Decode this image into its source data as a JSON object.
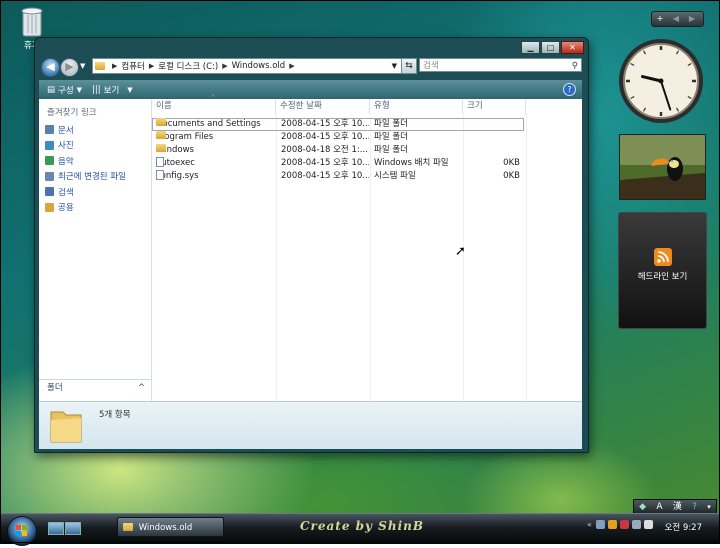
{
  "desktop": {
    "recycle_label": "휴지",
    "watermark": "Create by ShinB"
  },
  "window": {
    "address": {
      "segments": [
        "컴퓨터",
        "로컬 디스크 (C:)",
        "Windows.old"
      ]
    },
    "search_placeholder": "검색",
    "toolbar": {
      "organize": "구성",
      "views": "보기"
    },
    "nav": {
      "heading": "즐겨찾기 링크",
      "links": [
        {
          "label": "문서",
          "color": "#5a7fb5"
        },
        {
          "label": "사진",
          "color": "#3a8bc9"
        },
        {
          "label": "음악",
          "color": "#3a9a58"
        },
        {
          "label": "최근에 변경된 파일",
          "color": "#6a87b0"
        },
        {
          "label": "검색",
          "color": "#4a73b0"
        },
        {
          "label": "공용",
          "color": "#d9a638"
        }
      ],
      "folders_label": "폴더"
    },
    "columns": [
      "이름",
      "수정한 날짜",
      "유형",
      "크기"
    ],
    "files": [
      {
        "name": "Documents and Settings",
        "date": "2008-04-15 오후 10...",
        "type": "파일 폴더",
        "size": "",
        "icon": "folder"
      },
      {
        "name": "Program Files",
        "date": "2008-04-15 오후 10...",
        "type": "파일 폴더",
        "size": "",
        "icon": "folder"
      },
      {
        "name": "Windows",
        "date": "2008-04-18 오전 1:...",
        "type": "파일 폴더",
        "size": "",
        "icon": "folder"
      },
      {
        "name": "autoexec",
        "date": "2008-04-15 오후 10...",
        "type": "Windows 배치 파일",
        "size": "0KB",
        "icon": "batch-file"
      },
      {
        "name": "config.sys",
        "date": "2008-04-15 오후 10...",
        "type": "시스템 파일",
        "size": "0KB",
        "icon": "system-file"
      }
    ],
    "status_count": "5개 항목"
  },
  "sidebar": {
    "feed_label": "헤드라인 보기",
    "clock": {
      "hour": 9,
      "minute": 27
    }
  },
  "language_bar": {
    "ime_mode": "A",
    "hanja": "漢"
  },
  "taskbar": {
    "active_task": "Windows.old",
    "clock": "오전 9:27"
  }
}
